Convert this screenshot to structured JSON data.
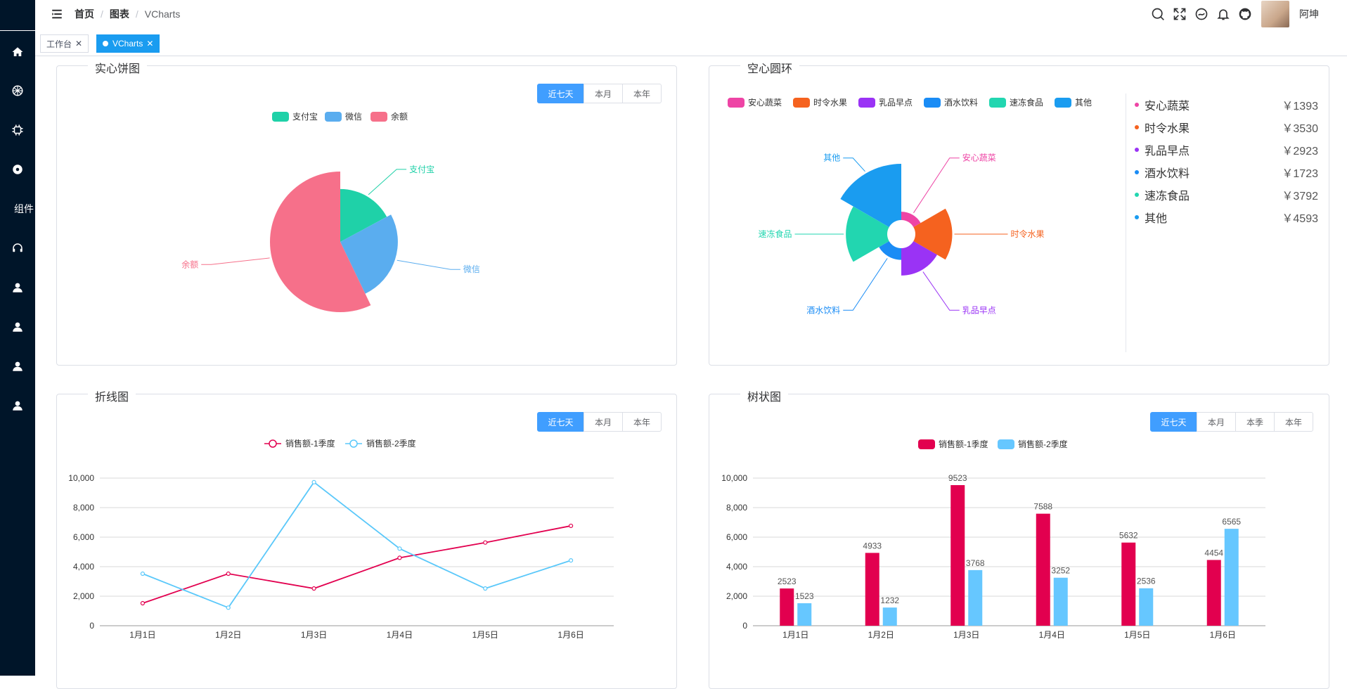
{
  "header": {
    "breadcrumb": [
      "首页",
      "图表",
      "VCharts"
    ],
    "username": "阿坤"
  },
  "sidebar": {
    "items": [
      {
        "icon": "home-icon"
      },
      {
        "icon": "dribbble-icon"
      },
      {
        "icon": "chip-icon"
      },
      {
        "icon": "disc-icon"
      },
      {
        "label": "组件"
      },
      {
        "icon": "headset-icon"
      },
      {
        "icon": "user-icon"
      },
      {
        "icon": "user-icon"
      },
      {
        "icon": "user-icon"
      },
      {
        "icon": "user-icon"
      }
    ]
  },
  "tags": [
    {
      "label": "工作台",
      "active": false
    },
    {
      "label": "VCharts",
      "active": true
    }
  ],
  "colors": {
    "accent": "#409eff",
    "sidebar": "#001529",
    "series1": "#e2004f",
    "series2": "#5ac8fa",
    "bar2": "#66c7ff"
  },
  "cards": {
    "pie": {
      "title": "实心饼图",
      "buttons": [
        "近七天",
        "本月",
        "本年"
      ]
    },
    "ring": {
      "title": "空心圆环"
    },
    "line": {
      "title": "折线图",
      "buttons": [
        "近七天",
        "本月",
        "本年"
      ]
    },
    "bar": {
      "title": "树状图",
      "buttons": [
        "近七天",
        "本月",
        "本季",
        "本年"
      ]
    }
  },
  "ring_summary": [
    {
      "name": "安心蔬菜",
      "value": "￥1393",
      "color": "#ee44a5"
    },
    {
      "name": "时令水果",
      "value": "￥3530",
      "color": "#f5621f"
    },
    {
      "name": "乳品早点",
      "value": "￥2923",
      "color": "#9a33f5"
    },
    {
      "name": "酒水饮料",
      "value": "￥1723",
      "color": "#1a8cf5"
    },
    {
      "name": "速冻食品",
      "value": "￥3792",
      "color": "#22d6b0"
    },
    {
      "name": "其他",
      "value": "￥4593",
      "color": "#1a9cf0"
    }
  ],
  "chart_data": [
    {
      "type": "pie",
      "variant": "rose",
      "legend": [
        "支付宝",
        "微信",
        "余额"
      ],
      "colors": [
        "#1fd1a8",
        "#5aadef",
        "#f6708a"
      ],
      "slices": [
        {
          "name": "支付宝",
          "value": 30
        },
        {
          "name": "微信",
          "value": 45
        },
        {
          "name": "余额",
          "value": 100
        }
      ]
    },
    {
      "type": "pie",
      "variant": "rose-ring",
      "legend": [
        "安心蔬菜",
        "时令水果",
        "乳品早点",
        "酒水饮料",
        "速冻食品",
        "其他"
      ],
      "colors": [
        "#ee44a5",
        "#f5621f",
        "#9a33f5",
        "#1a8cf5",
        "#22d6b0",
        "#1a9cf0"
      ],
      "slices": [
        {
          "name": "安心蔬菜",
          "value": 1393
        },
        {
          "name": "时令水果",
          "value": 3530
        },
        {
          "name": "乳品早点",
          "value": 2923
        },
        {
          "name": "酒水饮料",
          "value": 1723
        },
        {
          "name": "速冻食品",
          "value": 3792
        },
        {
          "name": "其他",
          "value": 4593
        }
      ]
    },
    {
      "type": "line",
      "categories": [
        "1月1日",
        "1月2日",
        "1月3日",
        "1月4日",
        "1月5日",
        "1月6日"
      ],
      "series": [
        {
          "name": "销售额-1季度",
          "values": [
            1523,
            3523,
            2523,
            4600,
            5633,
            6765
          ]
        },
        {
          "name": "销售额-2季度",
          "values": [
            3523,
            1223,
            9723,
            5223,
            2523,
            4423
          ]
        }
      ],
      "ylim": [
        0,
        10000
      ],
      "yticks": [
        "0",
        "2,000",
        "4,000",
        "6,000",
        "8,000",
        "10,000"
      ],
      "grid": true,
      "legend_position": "top"
    },
    {
      "type": "bar",
      "categories": [
        "1月1日",
        "1月2日",
        "1月3日",
        "1月4日",
        "1月5日",
        "1月6日"
      ],
      "series": [
        {
          "name": "销售额-1季度",
          "values": [
            2523,
            4933,
            9523,
            7588,
            5632,
            4454
          ]
        },
        {
          "name": "销售额-2季度",
          "values": [
            1523,
            1232,
            3768,
            3252,
            2536,
            6565
          ]
        }
      ],
      "ylim": [
        0,
        10000
      ],
      "yticks": [
        "0",
        "2,000",
        "4,000",
        "6,000",
        "8,000",
        "10,000"
      ],
      "grid": true,
      "legend_position": "top"
    }
  ]
}
